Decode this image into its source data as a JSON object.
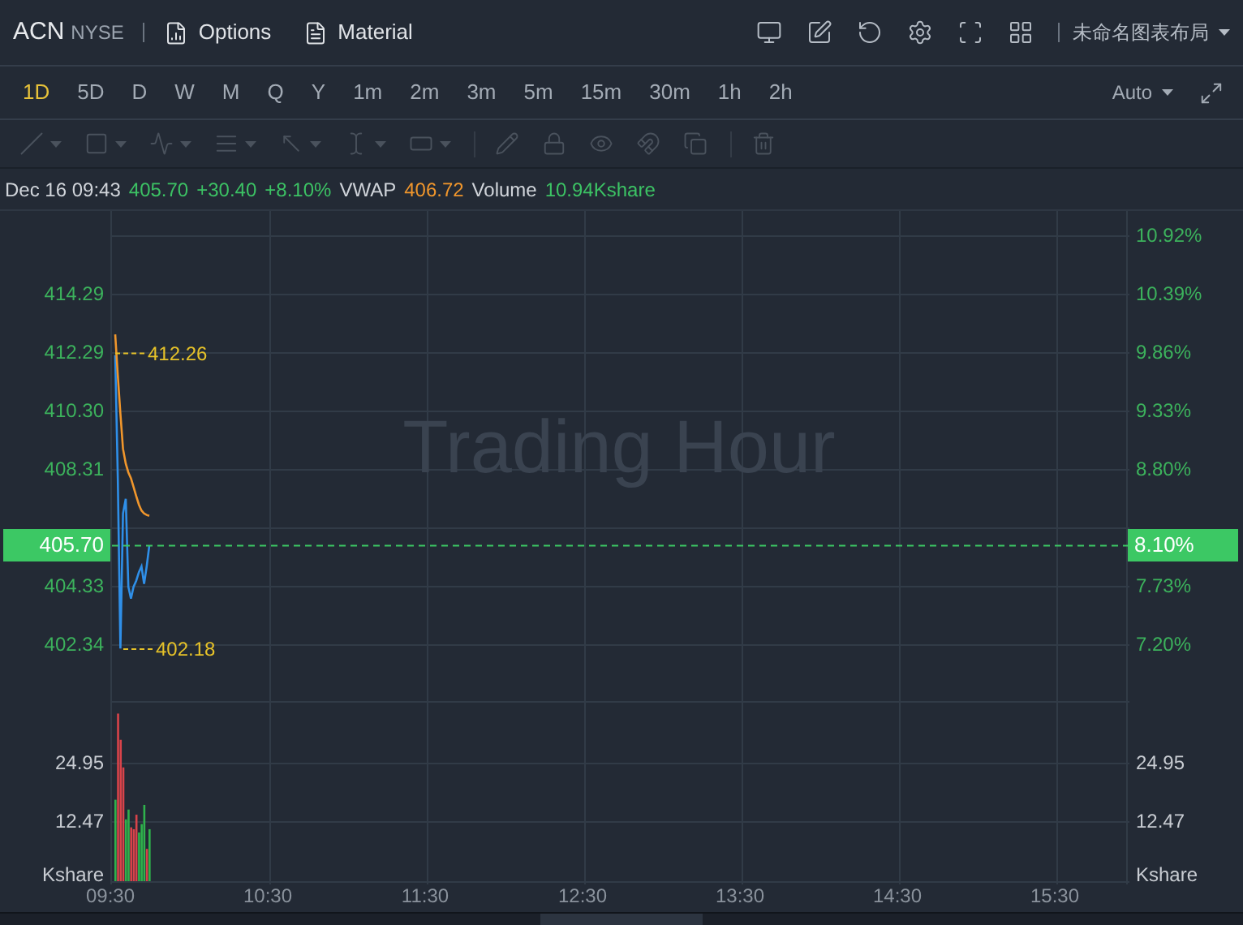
{
  "header": {
    "symbol": "ACN",
    "exchange": "NYSE",
    "links": [
      {
        "kind": "options",
        "label": "Options"
      },
      {
        "kind": "material",
        "label": "Material"
      }
    ],
    "layout_name": "未命名图表布局"
  },
  "intervals": [
    {
      "label": "1D",
      "selected": true
    },
    {
      "label": "5D",
      "selected": false
    },
    {
      "label": "D",
      "selected": false
    },
    {
      "label": "W",
      "selected": false
    },
    {
      "label": "M",
      "selected": false
    },
    {
      "label": "Q",
      "selected": false
    },
    {
      "label": "Y",
      "selected": false
    },
    {
      "label": "1m",
      "selected": false
    },
    {
      "label": "2m",
      "selected": false
    },
    {
      "label": "3m",
      "selected": false
    },
    {
      "label": "5m",
      "selected": false
    },
    {
      "label": "15m",
      "selected": false
    },
    {
      "label": "30m",
      "selected": false
    },
    {
      "label": "1h",
      "selected": false
    },
    {
      "label": "2h",
      "selected": false
    }
  ],
  "scale_mode": "Auto",
  "quote_line": [
    {
      "text": "Dec 16 09:43",
      "color": "#d0d4da"
    },
    {
      "text": "405.70",
      "color": "#3cc264"
    },
    {
      "text": "+30.40",
      "color": "#3cc264"
    },
    {
      "text": "+8.10%",
      "color": "#3cc264"
    },
    {
      "text": "VWAP",
      "color": "#d0d4da"
    },
    {
      "text": "406.72",
      "color": "#f0962c"
    },
    {
      "text": "Volume",
      "color": "#d0d4da"
    },
    {
      "text": "10.94Kshare",
      "color": "#3cc264"
    }
  ],
  "price_panel": {
    "overlay_text": "Trading Hour",
    "left_axis": [
      "414.29",
      "412.29",
      "410.30",
      "408.31",
      "404.33",
      "402.34"
    ],
    "right_axis": [
      "10.92%",
      "10.39%",
      "9.86%",
      "9.33%",
      "8.80%",
      "7.73%",
      "7.20%"
    ],
    "high_marker": "412.26",
    "low_marker": "402.18",
    "price_tag": "405.70",
    "change_tag": "8.10%"
  },
  "volume_panel": {
    "left_axis": [
      "24.95",
      "12.47"
    ],
    "left_unit": "Kshare",
    "right_axis": [
      "24.95",
      "12.47"
    ],
    "right_unit": "Kshare"
  },
  "time_axis": [
    "09:30",
    "10:30",
    "11:30",
    "12:30",
    "13:30",
    "14:30",
    "15:30"
  ]
}
